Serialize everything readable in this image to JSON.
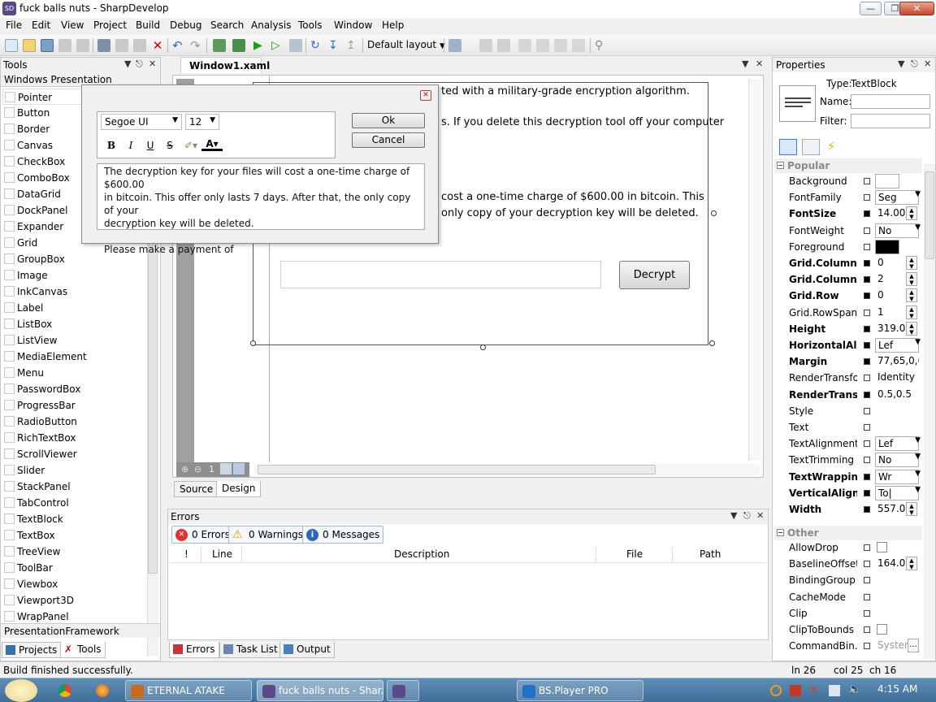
{
  "window": {
    "title": "fuck balls nuts - SharpDevelop",
    "icon_text": "SD"
  },
  "menu": [
    "File",
    "Edit",
    "View",
    "Project",
    "Build",
    "Debug",
    "Search",
    "Analysis",
    "Tools",
    "Window",
    "Help"
  ],
  "toolbar": {
    "layout_label": "Default layout"
  },
  "tools_panel": {
    "title": "Tools",
    "category": "Windows Presentation Foundation",
    "items": [
      "Pointer",
      "Button",
      "Border",
      "Canvas",
      "CheckBox",
      "ComboBox",
      "DataGrid",
      "DockPanel",
      "Expander",
      "Grid",
      "GroupBox",
      "Image",
      "InkCanvas",
      "Label",
      "ListBox",
      "ListView",
      "MediaElement",
      "Menu",
      "PasswordBox",
      "ProgressBar",
      "RadioButton",
      "RichTextBox",
      "ScrollViewer",
      "Slider",
      "StackPanel",
      "TabControl",
      "TextBlock",
      "TextBox",
      "TreeView",
      "ToolBar",
      "Viewbox",
      "Viewport3D",
      "WrapPanel"
    ],
    "bottom_category": "PresentationFramework",
    "tabs": [
      "Projects",
      "Tools"
    ]
  },
  "document": {
    "tab": "Window1.xaml",
    "line1": "ted with a military-grade encryption algorithm.",
    "line2": "s. If you delete this decryption tool off your computer",
    "line3": "cost a one-time charge of $600.00 in bitcoin. This",
    "line4": "only copy of your decryption key will be deleted.",
    "decrypt_button": "Decrypt",
    "zoom": "1",
    "source_tab": "Source",
    "design_tab": "Design"
  },
  "editor_popup": {
    "font": "Segoe UI",
    "size": "12",
    "bold": "B",
    "italic": "I",
    "underline": "U",
    "strike": "S",
    "ok": "Ok",
    "cancel": "Cancel",
    "text1": "The decryption key for your files will cost a one-time charge of $600.00",
    "text2": "in bitcoin. This offer only lasts 7 days. After that, the only copy of your",
    "text3": "decryption key will be deleted.",
    "text4": "Please make a payment of"
  },
  "errors_panel": {
    "title": "Errors",
    "errors": "0 Errors",
    "warnings": "0 Warnings",
    "messages": "0 Messages",
    "columns": [
      "!",
      "Line",
      "Description",
      "File",
      "Path"
    ],
    "tabs": [
      "Errors",
      "Task List",
      "Output"
    ]
  },
  "properties": {
    "title": "Properties",
    "type_label": "Type:",
    "type_value": "TextBlock",
    "name_label": "Name:",
    "filter_label": "Filter:",
    "group_popular": "Popular",
    "group_other": "Other",
    "popular": [
      {
        "name": "Background",
        "value": "",
        "set": false,
        "bold": false,
        "kind": "color-white"
      },
      {
        "name": "FontFamily",
        "value": "Seg",
        "set": false,
        "bold": false,
        "kind": "dropdown"
      },
      {
        "name": "FontSize",
        "value": "14.00",
        "set": true,
        "bold": true,
        "kind": "spin"
      },
      {
        "name": "FontWeight",
        "value": "No",
        "set": false,
        "bold": false,
        "kind": "dropdown"
      },
      {
        "name": "Foreground",
        "value": "",
        "set": false,
        "bold": false,
        "kind": "color-black"
      },
      {
        "name": "Grid.Column",
        "value": "0",
        "set": true,
        "bold": true,
        "kind": "spin"
      },
      {
        "name": "Grid.Column...",
        "value": "2",
        "set": true,
        "bold": true,
        "kind": "spin"
      },
      {
        "name": "Grid.Row",
        "value": "0",
        "set": true,
        "bold": true,
        "kind": "spin"
      },
      {
        "name": "Grid.RowSpan",
        "value": "1",
        "set": false,
        "bold": false,
        "kind": "spin"
      },
      {
        "name": "Height",
        "value": "319.00",
        "set": true,
        "bold": true,
        "kind": "spin"
      },
      {
        "name": "HorizontalAli...",
        "value": "Lef",
        "set": true,
        "bold": true,
        "kind": "dropdown"
      },
      {
        "name": "Margin",
        "value": "77,65,0,0",
        "set": true,
        "bold": true,
        "kind": "text"
      },
      {
        "name": "RenderTransfo...",
        "value": "Identity",
        "set": false,
        "bold": false,
        "kind": "text"
      },
      {
        "name": "RenderTrans...",
        "value": "0.5,0.5",
        "set": true,
        "bold": true,
        "kind": "text"
      },
      {
        "name": "Style",
        "value": "",
        "set": false,
        "bold": false,
        "kind": "text"
      },
      {
        "name": "Text",
        "value": "",
        "set": false,
        "bold": false,
        "kind": "text"
      },
      {
        "name": "TextAlignment",
        "value": "Lef",
        "set": false,
        "bold": false,
        "kind": "dropdown"
      },
      {
        "name": "TextTrimming",
        "value": "No",
        "set": false,
        "bold": false,
        "kind": "dropdown"
      },
      {
        "name": "TextWrapping",
        "value": "Wr",
        "set": true,
        "bold": true,
        "kind": "dropdown"
      },
      {
        "name": "VerticalAlign...",
        "value": "To|",
        "set": true,
        "bold": true,
        "kind": "dropdown"
      },
      {
        "name": "Width",
        "value": "557.00",
        "set": true,
        "bold": true,
        "kind": "spin"
      }
    ],
    "other": [
      {
        "name": "AllowDrop",
        "value": "",
        "set": false,
        "bold": false,
        "kind": "check"
      },
      {
        "name": "BaselineOffset",
        "value": "164.07",
        "set": false,
        "bold": false,
        "kind": "spin"
      },
      {
        "name": "BindingGroup",
        "value": "",
        "set": false,
        "bold": false,
        "kind": "text"
      },
      {
        "name": "CacheMode",
        "value": "",
        "set": false,
        "bold": false,
        "kind": "text"
      },
      {
        "name": "Clip",
        "value": "",
        "set": false,
        "bold": false,
        "kind": "text"
      },
      {
        "name": "ClipToBounds",
        "value": "",
        "set": false,
        "bold": false,
        "kind": "check"
      },
      {
        "name": "CommandBin...",
        "value": "Systen",
        "set": false,
        "bold": false,
        "kind": "ellipsis"
      }
    ]
  },
  "status": {
    "message": "Build finished successfully.",
    "ln": "ln 26",
    "col": "col 25",
    "ch": "ch 16"
  },
  "taskbar": {
    "tasks": [
      "ETERNAL ATAKE",
      "fuck balls nuts - Shar...",
      "",
      "BS.Player PRO"
    ],
    "clock": "4:15 AM"
  },
  "colors": {
    "accent": "#3f6e98",
    "selection_border": "#555555"
  }
}
